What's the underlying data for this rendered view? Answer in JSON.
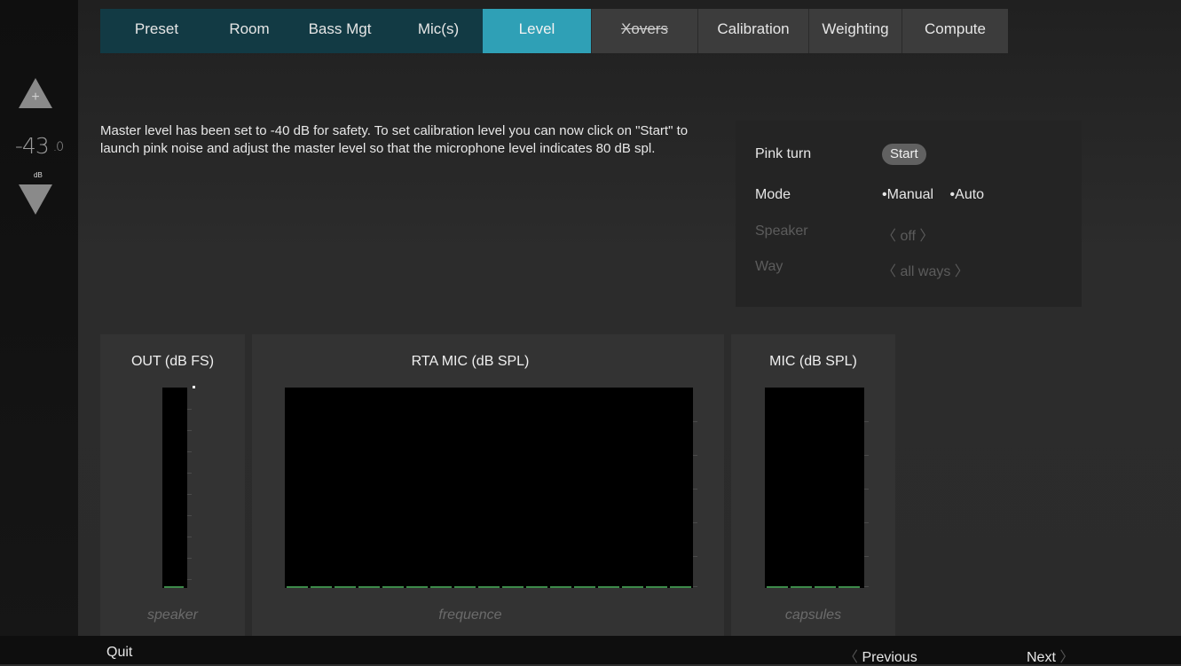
{
  "tabs": [
    {
      "label": "Preset"
    },
    {
      "label": "Room"
    },
    {
      "label": "Bass Mgt"
    },
    {
      "label": "Mic(s)"
    },
    {
      "label": "Level"
    },
    {
      "label": "Xovers"
    },
    {
      "label": "Calibration"
    },
    {
      "label": "Weighting"
    },
    {
      "label": "Compute"
    }
  ],
  "volume": {
    "value": "-43",
    "decimal": ".0",
    "unit": "dB"
  },
  "message": "Master level has been set to -40 dB for safety. To set calibration level you can now click on \"Start\" to launch pink noise and adjust the master level so that the microphone level indicates 80 dB spl.",
  "settings": {
    "pink_label": "Pink turn",
    "start_label": "Start",
    "mode_label": "Mode",
    "mode_manual": "Manual",
    "mode_auto": "Auto",
    "speaker_label": "Speaker",
    "speaker_value": "off",
    "way_label": "Way",
    "way_value": "all ways"
  },
  "meters": {
    "out": {
      "title": "OUT (dB FS)",
      "foot": "speaker"
    },
    "rta": {
      "title": "RTA MIC (dB SPL)",
      "foot": "frequence"
    },
    "mic": {
      "title": "MIC (dB SPL)",
      "foot": "capsules"
    }
  },
  "bottom": {
    "quit": "Quit",
    "previous": "Previous",
    "next": "Next"
  },
  "colors": {
    "active_tab": "#2fa0b6",
    "dark_tab": "#123a44",
    "meter_floor": "#3d8a4a"
  }
}
